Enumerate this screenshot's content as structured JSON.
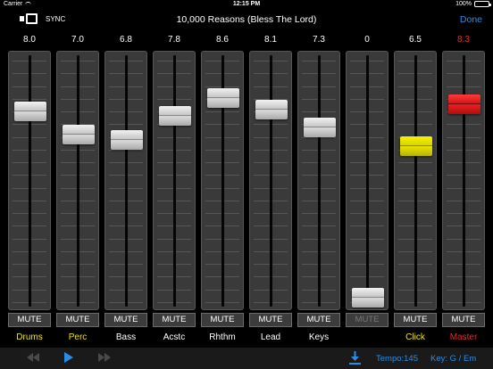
{
  "status_bar": {
    "carrier": "Carrier",
    "time": "12:15 PM",
    "battery": "100%"
  },
  "header": {
    "sync_label": "SYNC",
    "title": "10,000 Reasons (Bless The Lord)",
    "done_label": "Done"
  },
  "channels": [
    {
      "value": "8.0",
      "name": "Drums",
      "mute": "MUTE",
      "level": 0.8,
      "name_color": "#f2e600",
      "value_color": "#ffffff",
      "handle": "gray"
    },
    {
      "value": "7.0",
      "name": "Perc",
      "mute": "MUTE",
      "level": 0.7,
      "name_color": "#f2e600",
      "value_color": "#ffffff",
      "handle": "gray"
    },
    {
      "value": "6.8",
      "name": "Bass",
      "mute": "MUTE",
      "level": 0.68,
      "name_color": "#ffffff",
      "value_color": "#ffffff",
      "handle": "gray"
    },
    {
      "value": "7.8",
      "name": "Acstc",
      "mute": "MUTE",
      "level": 0.78,
      "name_color": "#ffffff",
      "value_color": "#ffffff",
      "handle": "gray"
    },
    {
      "value": "8.6",
      "name": "Rhthm",
      "mute": "MUTE",
      "level": 0.86,
      "name_color": "#ffffff",
      "value_color": "#ffffff",
      "handle": "gray"
    },
    {
      "value": "8.1",
      "name": "Lead",
      "mute": "MUTE",
      "level": 0.81,
      "name_color": "#ffffff",
      "value_color": "#ffffff",
      "handle": "gray"
    },
    {
      "value": "7.3",
      "name": "Keys",
      "mute": "MUTE",
      "level": 0.73,
      "name_color": "#ffffff",
      "value_color": "#ffffff",
      "handle": "gray"
    },
    {
      "value": "0",
      "name": "",
      "mute": "MUTE",
      "level": 0.0,
      "name_color": "#ffffff",
      "value_color": "#ffffff",
      "handle": "gray",
      "mute_dim": true
    },
    {
      "value": "6.5",
      "name": "Click",
      "mute": "MUTE",
      "level": 0.65,
      "name_color": "#f2e600",
      "value_color": "#ffffff",
      "handle": "yellow"
    },
    {
      "value": "8.3",
      "name": "Master",
      "mute": "MUTE",
      "level": 0.83,
      "name_color": "#e22b2b",
      "value_color": "#e22b2b",
      "handle": "red"
    }
  ],
  "transport": {
    "tempo": "Tempo:145",
    "key": "Key: G / Em"
  },
  "icons": {
    "sync": "sync-icon",
    "rewind": "rewind-icon",
    "play": "play-icon",
    "fast_forward": "fast-forward-icon",
    "download": "download-icon"
  },
  "colors": {
    "accent": "#2b8ce8",
    "yellow": "#f2e600",
    "red": "#e22b2b"
  }
}
